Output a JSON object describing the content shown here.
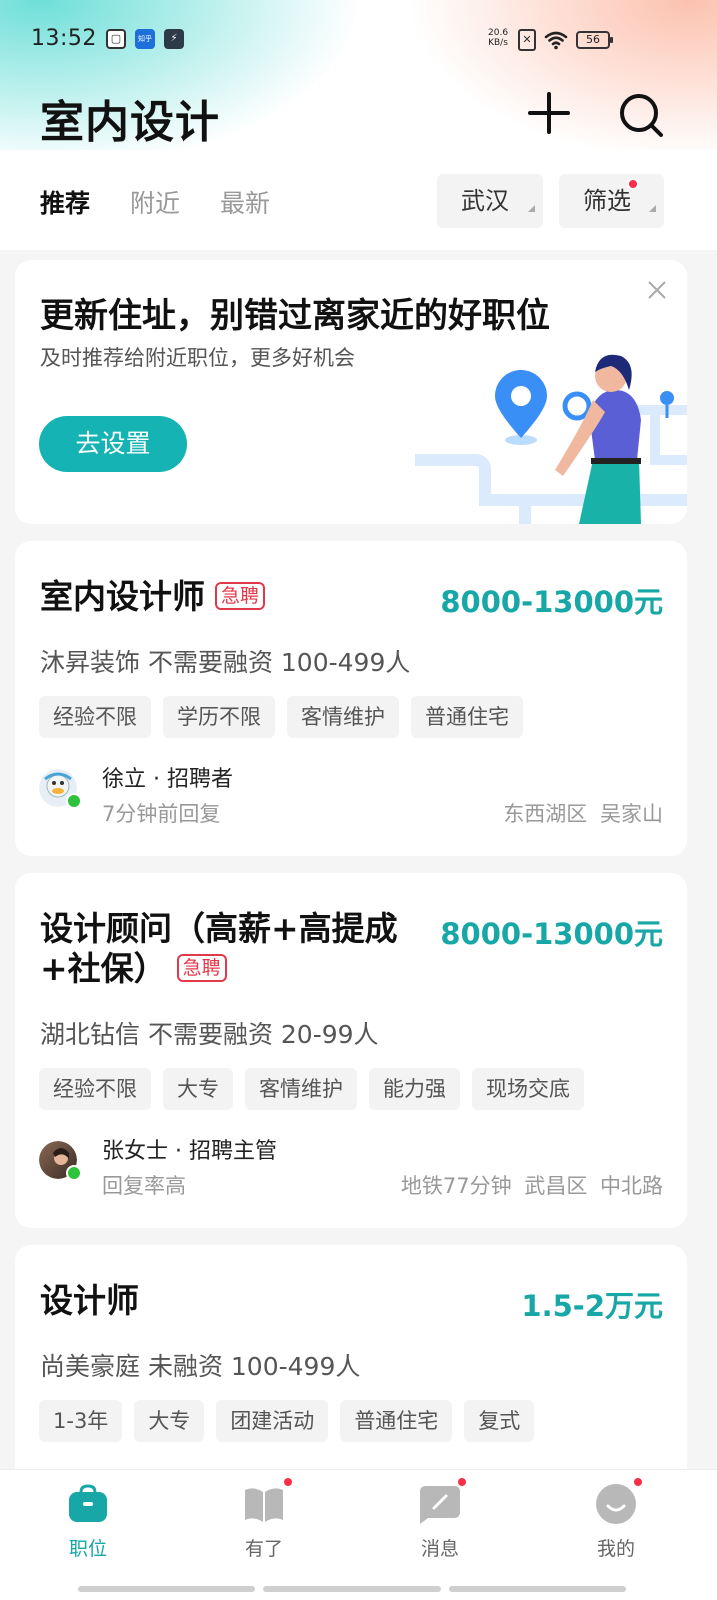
{
  "status_bar": {
    "time": "13:52",
    "net_speed_value": "20.6",
    "net_speed_unit": "KB/s",
    "sim_label": "✕",
    "battery": "56",
    "app_icons": [
      "square-app-icon",
      "zhihu-icon",
      "lightning-app-icon"
    ]
  },
  "header": {
    "title": "室内设计",
    "tabs": [
      {
        "label": "推荐",
        "active": true
      },
      {
        "label": "附近",
        "active": false
      },
      {
        "label": "最新",
        "active": false
      }
    ],
    "city": "武汉",
    "filter": "筛选"
  },
  "promo": {
    "title": "更新住址，别错过离家近的好职位",
    "subtitle": "及时推荐给附近职位，更多好机会",
    "button": "去设置"
  },
  "jobs": [
    {
      "title": "室内设计师",
      "urgent": "急聘",
      "salary": "8000-13000元",
      "company": "沐昇装饰  不需要融资  100-499人",
      "tags": [
        "经验不限",
        "学历不限",
        "客情维护",
        "普通住宅"
      ],
      "recruiter": "徐立 · 招聘者",
      "reply": "7分钟前回复",
      "location": "东西湖区  吴家山"
    },
    {
      "title_line1": "设计顾问（高薪+高提成",
      "title_line2": "+社保）",
      "urgent": "急聘",
      "salary": "8000-13000元",
      "company": "湖北钻信  不需要融资  20-99人",
      "tags": [
        "经验不限",
        "大专",
        "客情维护",
        "能力强",
        "现场交底"
      ],
      "recruiter": "张女士 · 招聘主管",
      "reply": "回复率高",
      "location": "地铁77分钟  武昌区  中北路"
    },
    {
      "title": "设计师",
      "salary": "1.5-2万元",
      "company": "尚美豪庭  未融资  100-499人",
      "tags": [
        "1-3年",
        "大专",
        "团建活动",
        "普通住宅",
        "复式"
      ]
    }
  ],
  "bottom_nav": [
    {
      "label": "职位",
      "icon": "briefcase-icon",
      "active": true
    },
    {
      "label": "有了",
      "icon": "book-icon",
      "active": false
    },
    {
      "label": "消息",
      "icon": "chat-icon",
      "active": false
    },
    {
      "label": "我的",
      "icon": "profile-icon",
      "active": false
    }
  ],
  "colors": {
    "accent": "#16a7a6",
    "urgent": "#e2394a",
    "badge": "#fa2d48",
    "online": "#2dc33c"
  }
}
